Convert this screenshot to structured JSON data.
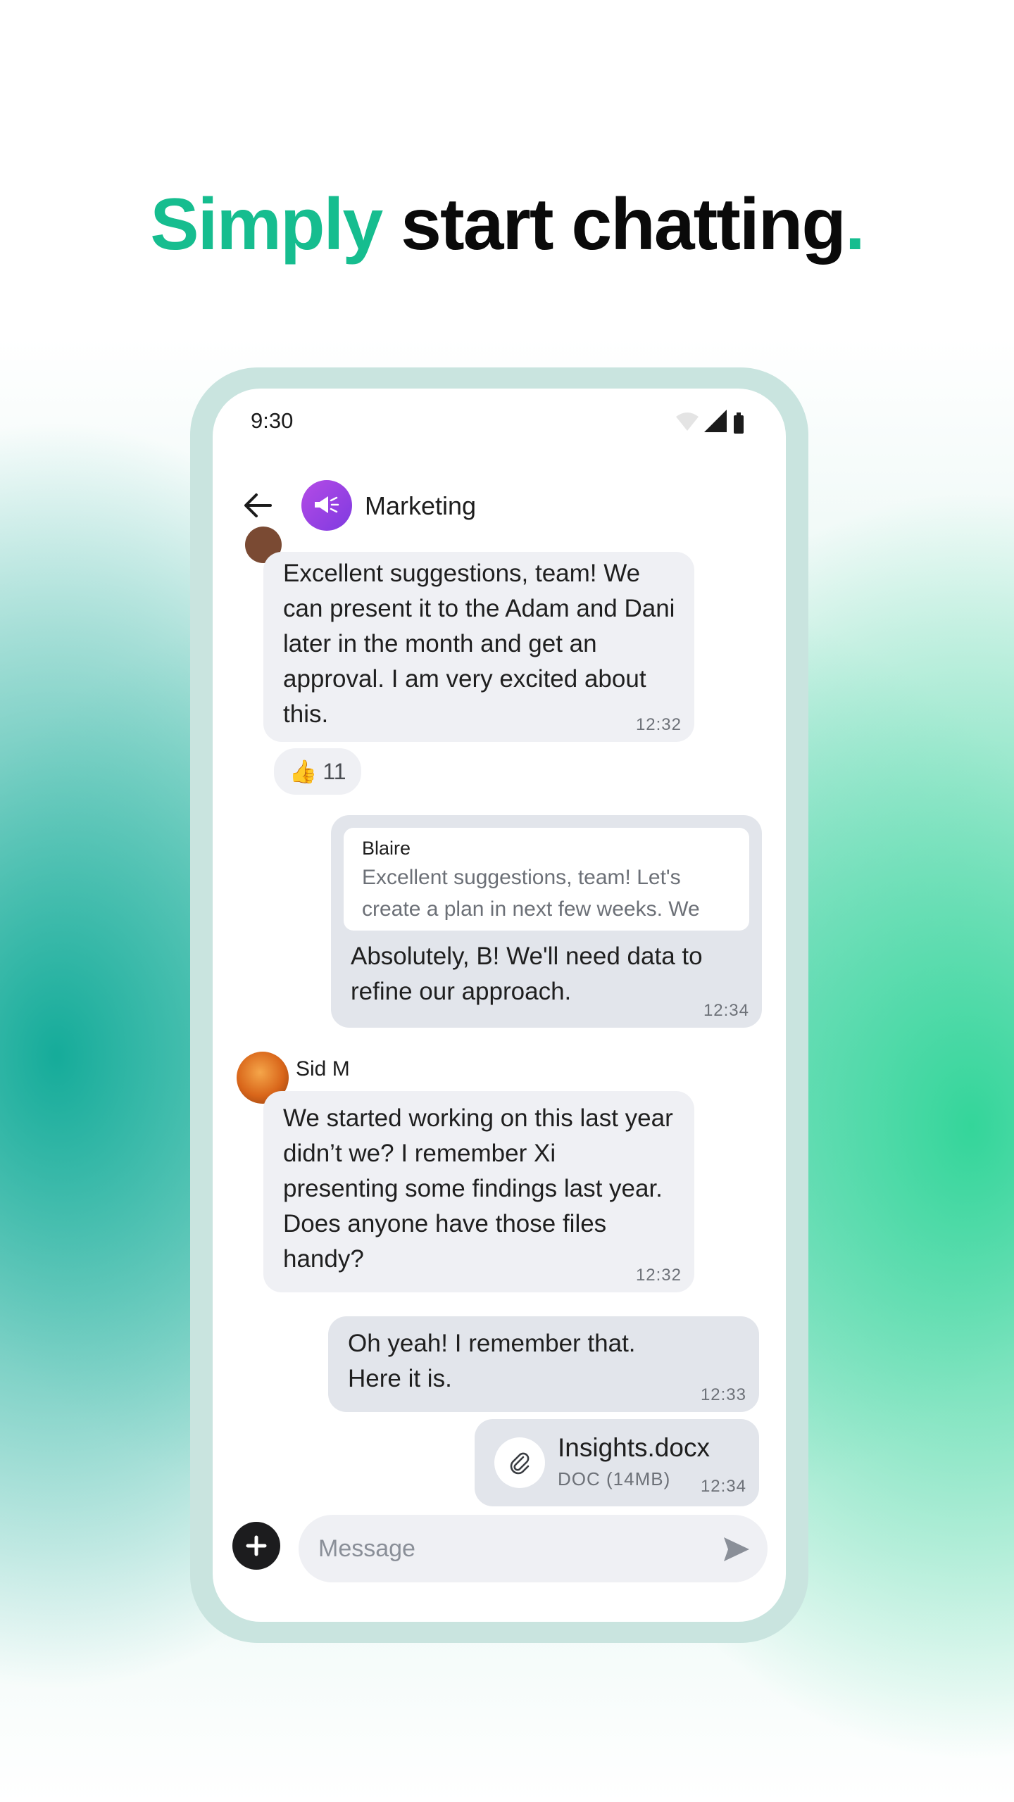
{
  "headline": {
    "accent": "Simply",
    "rest": " start chatting",
    "dot": "."
  },
  "status_bar": {
    "time": "9:30",
    "icons": [
      "wifi-icon",
      "signal-icon",
      "battery-icon"
    ]
  },
  "header": {
    "title": "Marketing",
    "avatar_icon": "megaphone-icon"
  },
  "messages": [
    {
      "text": "Excellent suggestions, team! We can present it to the Adam and Dani later in the month and get an approval. I am very excited about this.",
      "time": "12:32",
      "reaction": {
        "emoji": "👍",
        "count": "11"
      }
    },
    {
      "reply_to": {
        "author": "Blaire",
        "text": "Excellent suggestions, team! Let's create a plan in next few weeks. We"
      },
      "text": "Absolutely, B! We'll need data to refine our approach.",
      "time": "12:34"
    },
    {
      "sender": "Sid M",
      "text": "We started working on this last year didn’t we? I remember Xi presenting some findings last year. Does anyone have those files handy?",
      "time": "12:32"
    },
    {
      "text": "Oh yeah! I remember that. Here it is.",
      "time": "12:33"
    },
    {
      "attachment": {
        "name": "Insights.docx",
        "size": "DOC (14MB)"
      },
      "time": "12:34"
    }
  ],
  "composer": {
    "placeholder": "Message"
  },
  "colors": {
    "accent": "#16bd8f",
    "group_avatar": "#9b45e4",
    "bubble_in": "#eff0f4",
    "bubble_out": "#e2e5eb"
  }
}
